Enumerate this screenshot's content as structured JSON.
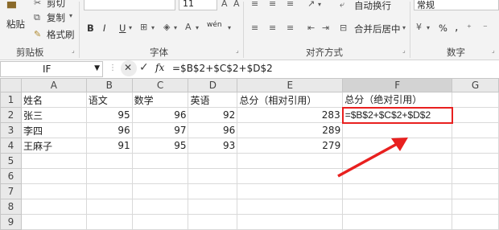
{
  "ribbon": {
    "clipboard": {
      "paste": "粘贴",
      "cut": "剪切",
      "copy": "复制",
      "format_painter": "格式刷",
      "group_label": "剪贴板"
    },
    "font": {
      "size": "11",
      "group_label": "字体",
      "bold": "B",
      "italic": "I",
      "underline": "U",
      "wen": "wén"
    },
    "alignment": {
      "wrap_text": "自动换行",
      "merge_center": "合并后居中",
      "group_label": "对齐方式"
    },
    "number": {
      "format": "常规",
      "group_label": "数字",
      "percent": "%",
      "comma": ","
    }
  },
  "formula_bar": {
    "name_box": "IF",
    "cancel": "✕",
    "enter": "✓",
    "fx": "fx",
    "formula": "=$B$2+$C$2+$D$2"
  },
  "sheet": {
    "columns": [
      "A",
      "B",
      "C",
      "D",
      "E",
      "F",
      "G"
    ],
    "rows": [
      {
        "num": "1",
        "cells": [
          "姓名",
          "语文",
          "数学",
          "英语",
          "总分（相对引用）",
          "总分（绝对引用）",
          ""
        ]
      },
      {
        "num": "2",
        "cells": [
          "张三",
          "95",
          "96",
          "92",
          "283",
          "=$B$2+$C$2+$D$2",
          ""
        ]
      },
      {
        "num": "3",
        "cells": [
          "李四",
          "96",
          "97",
          "96",
          "289",
          "",
          ""
        ]
      },
      {
        "num": "4",
        "cells": [
          "王麻子",
          "91",
          "95",
          "93",
          "279",
          "",
          ""
        ]
      },
      {
        "num": "5",
        "cells": [
          "",
          "",
          "",
          "",
          "",
          "",
          ""
        ]
      },
      {
        "num": "6",
        "cells": [
          "",
          "",
          "",
          "",
          "",
          "",
          ""
        ]
      },
      {
        "num": "7",
        "cells": [
          "",
          "",
          "",
          "",
          "",
          "",
          ""
        ]
      },
      {
        "num": "8",
        "cells": [
          "",
          "",
          "",
          "",
          "",
          "",
          ""
        ]
      },
      {
        "num": "9",
        "cells": [
          "",
          "",
          "",
          "",
          "",
          "",
          ""
        ]
      }
    ]
  },
  "colors": {
    "annotation": "#e8201f",
    "header_bg": "#e9e9e9",
    "selected_header": "#d3d3d3"
  }
}
